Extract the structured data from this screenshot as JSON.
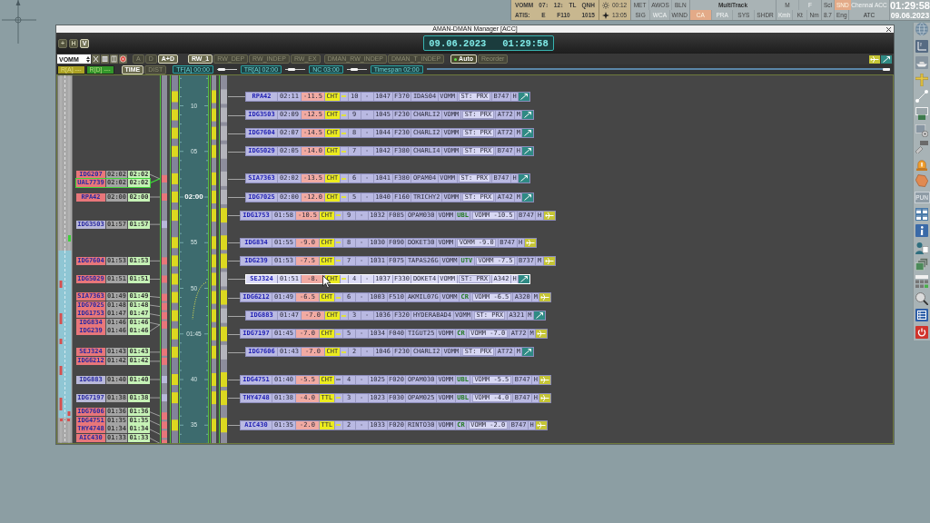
{
  "status_strip": {
    "info_rows": [
      [
        "VOMM",
        "07↕",
        "12↕",
        "TL",
        "QNH"
      ],
      [
        "ATIS:",
        "E",
        "F110",
        "1015"
      ]
    ],
    "sun_times": [
      {
        "kind": "sunrise",
        "time": "00:12"
      },
      {
        "kind": "sunset",
        "time": "13:05"
      }
    ],
    "toggle_groups": [
      {
        "rows": [
          [
            {
              "label": "MET",
              "on": false,
              "disabled": false
            },
            {
              "label": "AWOS",
              "on": false,
              "disabled": false
            },
            {
              "label": "BLN",
              "on": false,
              "disabled": false
            }
          ],
          [
            {
              "label": "SIG",
              "on": false,
              "disabled": false
            },
            {
              "label": "WCA",
              "on": false,
              "disabled": true
            },
            {
              "label": "WIND",
              "on": false,
              "disabled": false
            }
          ]
        ]
      },
      {
        "title": "MultiTrack",
        "rows": [
          [
            {
              "label": "CA",
              "on": true,
              "disabled": false
            },
            {
              "label": "PRA",
              "on": false,
              "disabled": true
            },
            {
              "label": "SYS",
              "on": false,
              "disabled": false
            },
            {
              "label": "SHDR",
              "on": false,
              "disabled": false
            }
          ]
        ]
      },
      {
        "rows": [
          [
            {
              "label": "M",
              "on": false,
              "disabled": false
            },
            {
              "label": "F",
              "on": false,
              "disabled": true
            }
          ],
          [
            {
              "label": "Kmh",
              "on": false,
              "disabled": true
            },
            {
              "label": "Kt",
              "on": false,
              "disabled": false
            },
            {
              "label": "Nm",
              "on": false,
              "disabled": false
            }
          ]
        ]
      },
      {
        "rows": [
          [
            {
              "label": "Scl",
              "on": false,
              "disabled": false
            },
            {
              "label": "SND",
              "on": true,
              "disabled": false
            }
          ],
          [
            {
              "label": "8.7",
              "on": false,
              "disabled": false
            },
            {
              "label": "Eng",
              "on": false,
              "disabled": false
            }
          ]
        ]
      }
    ],
    "sector": {
      "name": "Chennai ACC",
      "role": "ATC"
    },
    "clock": {
      "time": "01:29:58",
      "date": "09.06.2023"
    }
  },
  "window": {
    "title": "AMAN-DMAN Manager [ACC]"
  },
  "header": {
    "view_buttons": [
      {
        "label": "+",
        "selected": false
      },
      {
        "label": "H",
        "selected": false
      },
      {
        "label": "V",
        "selected": true
      }
    ],
    "date": "09.06.2023",
    "time": "01:29:58"
  },
  "toolbar": {
    "airport": "VOMM",
    "mode_buttons": [
      {
        "label": "A",
        "selected": false
      },
      {
        "label": "D",
        "selected": false
      },
      {
        "label": "A+D",
        "selected": true
      }
    ],
    "runway_buttons": [
      {
        "label": "RW_1",
        "selected": true
      },
      {
        "label": "RW_DEP",
        "selected": false
      },
      {
        "label": "RW_INDEP",
        "selected": false
      },
      {
        "label": "RW_EX",
        "selected": false
      }
    ],
    "dman_buttons": [
      {
        "label": "DMAN_RW_INDEP",
        "selected": false
      },
      {
        "label": "DMAN_T_INDEP",
        "selected": false
      }
    ],
    "sequence_buttons": [
      {
        "label": "Auto",
        "on": true
      },
      {
        "label": "Reorder",
        "on": false
      }
    ]
  },
  "filter_bar": {
    "range_buttons": [
      {
        "label": "R[A] ---",
        "color": "#aba224"
      },
      {
        "label": "R[D] ---",
        "color": "#32962a"
      }
    ],
    "axis_buttons": [
      {
        "label": "TIME",
        "selected": true
      },
      {
        "label": "DIST",
        "selected": false
      }
    ],
    "timers": [
      {
        "label": "TF[A] 00:00",
        "level": 0.1
      },
      {
        "label": "TR[A] 02:00",
        "level": 0.2
      },
      {
        "label": "NC 03:00",
        "level": 0.3
      },
      {
        "label": "Timespan 02:00",
        "level": 1
      }
    ]
  },
  "timeline": {
    "scale_labels": [
      {
        "text": "10",
        "major": false
      },
      {
        "text": "05",
        "major": false
      },
      {
        "text": "02:00",
        "major": true
      },
      {
        "text": "55",
        "major": false
      },
      {
        "text": "50",
        "major": false
      },
      {
        "text": "01:45",
        "major": false
      },
      {
        "text": "40",
        "major": false
      },
      {
        "text": "35",
        "major": false
      }
    ]
  },
  "arrival_labels": [
    {
      "callsign": "IDG207",
      "eta": "02:02",
      "sta": "02:02",
      "color": "#e8767a",
      "selected": false
    },
    {
      "callsign": "UAL7739",
      "eta": "02:02",
      "sta": "02:02",
      "color": "#e8767a",
      "selected": true
    },
    {
      "callsign": "RPA42",
      "eta": "02:00",
      "sta": "02:00",
      "color": "#e8767a",
      "selected": false
    },
    {
      "callsign": "IDG3503",
      "eta": "01:57",
      "sta": "01:57",
      "color": "#b9b9da",
      "selected": false
    },
    {
      "callsign": "IDG7604",
      "eta": "01:53",
      "sta": "01:53",
      "color": "#e8767a",
      "selected": false
    },
    {
      "callsign": "IDG5029",
      "eta": "01:51",
      "sta": "01:51",
      "color": "#e8767a",
      "selected": false
    },
    {
      "callsign": "SIA7363",
      "eta": "01:49",
      "sta": "01:49",
      "color": "#e8767a",
      "selected": false
    },
    {
      "callsign": "IDG7025",
      "eta": "01:48",
      "sta": "01:48",
      "color": "#e8767a",
      "selected": false
    },
    {
      "callsign": "IDG1753",
      "eta": "01:47",
      "sta": "01:47",
      "color": "#e8767a",
      "selected": false
    },
    {
      "callsign": "IDG834",
      "eta": "01:46",
      "sta": "01:46",
      "color": "#e8767a",
      "selected": false
    },
    {
      "callsign": "IDG239",
      "eta": "01:46",
      "sta": "01:46",
      "color": "#e8767a",
      "selected": false
    },
    {
      "callsign": "SEJ324",
      "eta": "01:43",
      "sta": "01:43",
      "color": "#e8767a",
      "selected": false
    },
    {
      "callsign": "IDG6212",
      "eta": "01:42",
      "sta": "01:42",
      "color": "#e8767a",
      "selected": false
    },
    {
      "callsign": "IDG883",
      "eta": "01:40",
      "sta": "01:40",
      "color": "#b9b9da",
      "selected": false
    },
    {
      "callsign": "IDG7197",
      "eta": "01:38",
      "sta": "01:38",
      "color": "#b9b9da",
      "selected": false
    },
    {
      "callsign": "IDG7606",
      "eta": "01:36",
      "sta": "01:36",
      "color": "#e8767a",
      "selected": false
    },
    {
      "callsign": "IDG4751",
      "eta": "01:35",
      "sta": "01:35",
      "color": "#e8767a",
      "selected": false
    },
    {
      "callsign": "THY4748",
      "eta": "01:34",
      "sta": "01:34",
      "color": "#e8767a",
      "selected": false
    },
    {
      "callsign": "AIC430",
      "eta": "01:33",
      "sta": "01:33",
      "color": "#e8767a",
      "selected": false
    }
  ],
  "flight_strips": [
    {
      "kind": "proximity",
      "callsign": "RPA42",
      "time": "02:11",
      "delay": "-11.5",
      "procedure": "CHT",
      "hold": true,
      "sequence": "10",
      "status": "-",
      "code": "1047",
      "flight_level": "F370",
      "route": "IDAS04",
      "airport": "VOMM",
      "approach_status": "ST: PRX",
      "aircraft": "B747",
      "wake": "H",
      "selected": false
    },
    {
      "kind": "proximity",
      "callsign": "IDG3503",
      "time": "02:09",
      "delay": "-12.5",
      "procedure": "CHT",
      "hold": true,
      "sequence": "9",
      "status": "-",
      "code": "1045",
      "flight_level": "F230",
      "route": "CHARLI2",
      "airport": "VOMM",
      "approach_status": "ST: PRX",
      "aircraft": "AT72",
      "wake": "M",
      "selected": false
    },
    {
      "kind": "proximity",
      "callsign": "IDG7604",
      "time": "02:07",
      "delay": "-14.5",
      "procedure": "CHT",
      "hold": true,
      "sequence": "8",
      "status": "-",
      "code": "1044",
      "flight_level": "F230",
      "route": "CHARLI2",
      "airport": "VOMM",
      "approach_status": "ST: PRX",
      "aircraft": "AT72",
      "wake": "M",
      "selected": false
    },
    {
      "kind": "proximity",
      "callsign": "IDG5029",
      "time": "02:05",
      "delay": "-14.0",
      "procedure": "CHT",
      "hold": true,
      "sequence": "7",
      "status": "-",
      "code": "1042",
      "flight_level": "F380",
      "route": "CHARLI4",
      "airport": "VOMM",
      "approach_status": "ST: PRX",
      "aircraft": "B747",
      "wake": "H",
      "selected": false
    },
    {
      "kind": "proximity",
      "callsign": "SIA7363",
      "time": "02:02",
      "delay": "-13.5",
      "procedure": "CHT",
      "hold": true,
      "sequence": "6",
      "status": "-",
      "code": "1041",
      "flight_level": "F380",
      "route": "OPAM04",
      "airport": "VOMM",
      "approach_status": "ST: PRX",
      "aircraft": "B747",
      "wake": "H",
      "selected": false
    },
    {
      "kind": "proximity",
      "callsign": "IDG7025",
      "time": "02:00",
      "delay": "-12.0",
      "procedure": "CHT",
      "hold": true,
      "sequence": "5",
      "status": "-",
      "code": "1040",
      "flight_level": "F160",
      "route": "TRICHY2",
      "airport": "VOMM",
      "approach_status": "ST: PRX",
      "aircraft": "AT42",
      "wake": "M",
      "selected": false
    },
    {
      "kind": "route",
      "callsign": "IDG1753",
      "time": "01:58",
      "delay": "-10.5",
      "procedure": "CHT",
      "hold": true,
      "sequence": "9",
      "status": "-",
      "code": "1032",
      "flight_level": "F085",
      "route": "OPAM030",
      "airport": "VOMM",
      "exit": "UBL",
      "estimate": "VOMM -10.5",
      "aircraft": "B747",
      "wake": "H",
      "selected": false
    },
    {
      "kind": "route",
      "callsign": "IDG834",
      "time": "01:55",
      "delay": "-9.0",
      "procedure": "CHT",
      "hold": true,
      "sequence": "8",
      "status": "-",
      "code": "1030",
      "flight_level": "F090",
      "route": "DOKET30",
      "airport": "VOMM",
      "estimate": "VOMM -9.0",
      "aircraft": "B747",
      "wake": "H",
      "selected": false
    },
    {
      "kind": "route",
      "callsign": "IDG239",
      "time": "01:53",
      "delay": "-7.5",
      "procedure": "CHT",
      "hold": true,
      "sequence": "7",
      "status": "-",
      "code": "1031",
      "flight_level": "F075",
      "route": "TAPAS26G",
      "airport": "VOMM",
      "exit": "UTV",
      "estimate": "VOMM -7.5",
      "aircraft": "B737",
      "wake": "M",
      "selected": false
    },
    {
      "kind": "proximity",
      "callsign": "SEJ324",
      "time": "01:51",
      "delay": "-8.",
      "procedure": "CHT",
      "hold": true,
      "sequence": "4",
      "status": "-",
      "code": "1037",
      "flight_level": "F330",
      "route": "DOKET4",
      "airport": "VOMM",
      "approach_status": "ST: PRX",
      "aircraft": "A342",
      "wake": "H",
      "selected": true
    },
    {
      "kind": "route",
      "callsign": "IDG6212",
      "time": "01:49",
      "delay": "-6.5",
      "procedure": "CHT",
      "hold": true,
      "sequence": "6",
      "status": "-",
      "code": "1003",
      "flight_level": "F510",
      "route": "AKMIL07G",
      "airport": "VOMM",
      "exit": "CR",
      "estimate": "VOMM -6.5",
      "aircraft": "A320",
      "wake": "M",
      "selected": false
    },
    {
      "kind": "proximity",
      "callsign": "IDG883",
      "time": "01:47",
      "delay": "-7.0",
      "procedure": "CHT",
      "hold": true,
      "sequence": "3",
      "status": "-",
      "code": "1036",
      "flight_level": "F320",
      "route": "HYDERABAD4",
      "airport": "VOMM",
      "approach_status": "ST: PRX",
      "aircraft": "A321",
      "wake": "M",
      "selected": false
    },
    {
      "kind": "route",
      "callsign": "IDG7197",
      "time": "01:45",
      "delay": "-7.0",
      "procedure": "CHT",
      "hold": true,
      "sequence": "5",
      "status": "-",
      "code": "1034",
      "flight_level": "F040",
      "route": "TIGUT25",
      "airport": "VOMM",
      "exit": "CR",
      "estimate": "VOMM -7.0",
      "aircraft": "AT72",
      "wake": "M",
      "selected": false
    },
    {
      "kind": "proximity",
      "callsign": "IDG7606",
      "time": "01:43",
      "delay": "-7.0",
      "procedure": "CHT",
      "hold": true,
      "sequence": "2",
      "status": "-",
      "code": "1046",
      "flight_level": "F230",
      "route": "CHARLI2",
      "airport": "VOMM",
      "approach_status": "ST: PRX",
      "aircraft": "AT72",
      "wake": "M",
      "selected": false
    },
    {
      "kind": "route",
      "callsign": "IDG4751",
      "time": "01:40",
      "delay": "-5.5",
      "procedure": "CHT",
      "hold": false,
      "sequence": "4",
      "status": "-",
      "code": "1025",
      "flight_level": "F020",
      "route": "OPAM030",
      "airport": "VOMM",
      "exit": "UBL",
      "estimate": "VOMM -5.5",
      "aircraft": "B747",
      "wake": "H",
      "selected": false
    },
    {
      "kind": "route",
      "callsign": "THY4748",
      "time": "01:38",
      "delay": "-4.0",
      "procedure": "TTL",
      "hold": true,
      "sequence": "3",
      "status": "-",
      "code": "1023",
      "flight_level": "F030",
      "route": "OPAM025",
      "airport": "VOMM",
      "exit": "UBL",
      "estimate": "VOMM -4.0",
      "aircraft": "B747",
      "wake": "H",
      "selected": false
    },
    {
      "kind": "route",
      "callsign": "AIC430",
      "time": "01:35",
      "delay": "-2.0",
      "procedure": "TTL",
      "hold": true,
      "sequence": "2",
      "status": "-",
      "code": "1033",
      "flight_level": "F020",
      "route": "RINTO30",
      "airport": "VOMM",
      "exit": "CR",
      "estimate": "VOMM -2.0",
      "aircraft": "B747",
      "wake": "H",
      "selected": false
    }
  ],
  "side_toolbar": {
    "text_button": "PUN"
  }
}
